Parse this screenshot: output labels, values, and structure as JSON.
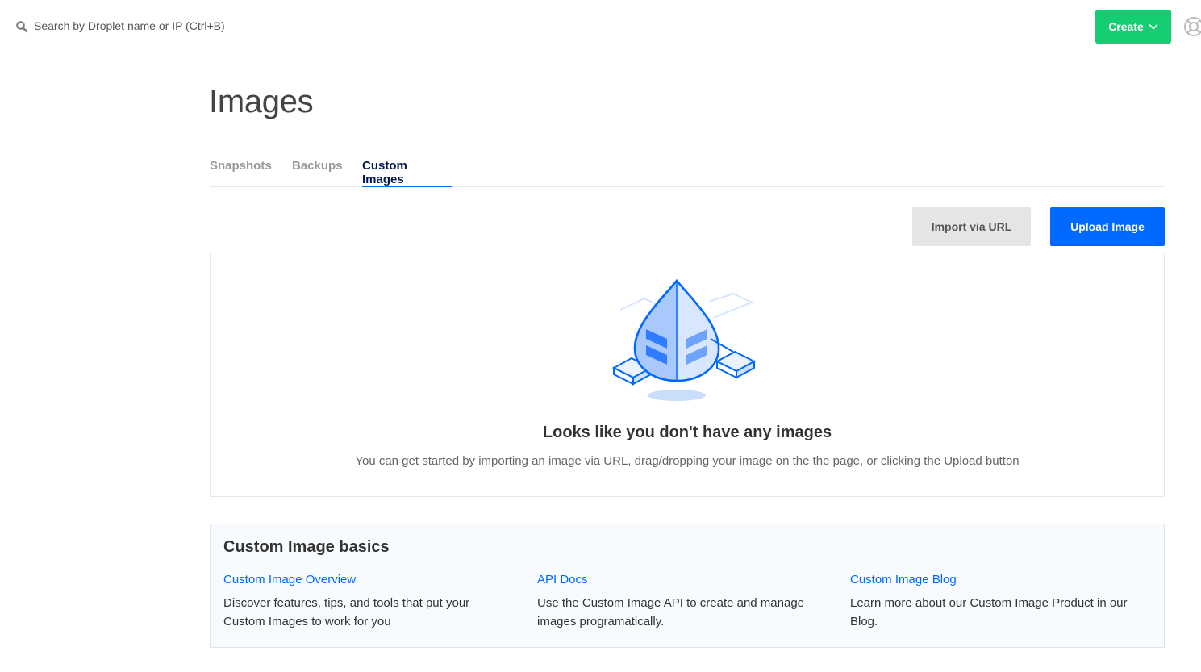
{
  "header": {
    "search": {
      "placeholder": "Search by Droplet name or IP (Ctrl+B)",
      "icon": "search-icon"
    },
    "create_label": "Create",
    "help_icon": "help-icon"
  },
  "page": {
    "title": "Images",
    "tabs": [
      {
        "label": "Snapshots",
        "active": false
      },
      {
        "label": "Backups",
        "active": false
      },
      {
        "label": "Custom Images",
        "active": true
      }
    ],
    "actions": {
      "import_label": "Import via URL",
      "upload_label": "Upload Image"
    }
  },
  "empty_state": {
    "illustration": "droplet-servers-illustration",
    "title": "Looks like you don't have any images",
    "description": "You can get started by importing an image via URL, drag/dropping your image on the the page, or clicking the Upload button"
  },
  "basics": {
    "title": "Custom Image basics",
    "items": [
      {
        "link": "Custom Image Overview",
        "text": "Discover features, tips, and tools that put your Custom Images to work for you"
      },
      {
        "link": "API Docs",
        "text": "Use the Custom Image API to create and manage images programatically."
      },
      {
        "link": "Custom Image Blog",
        "text": "Learn more about our Custom Image Product in our Blog."
      }
    ]
  },
  "colors": {
    "primary_blue": "#0069ff",
    "create_green": "#15cd72",
    "active_tab_text": "#031b4e"
  }
}
